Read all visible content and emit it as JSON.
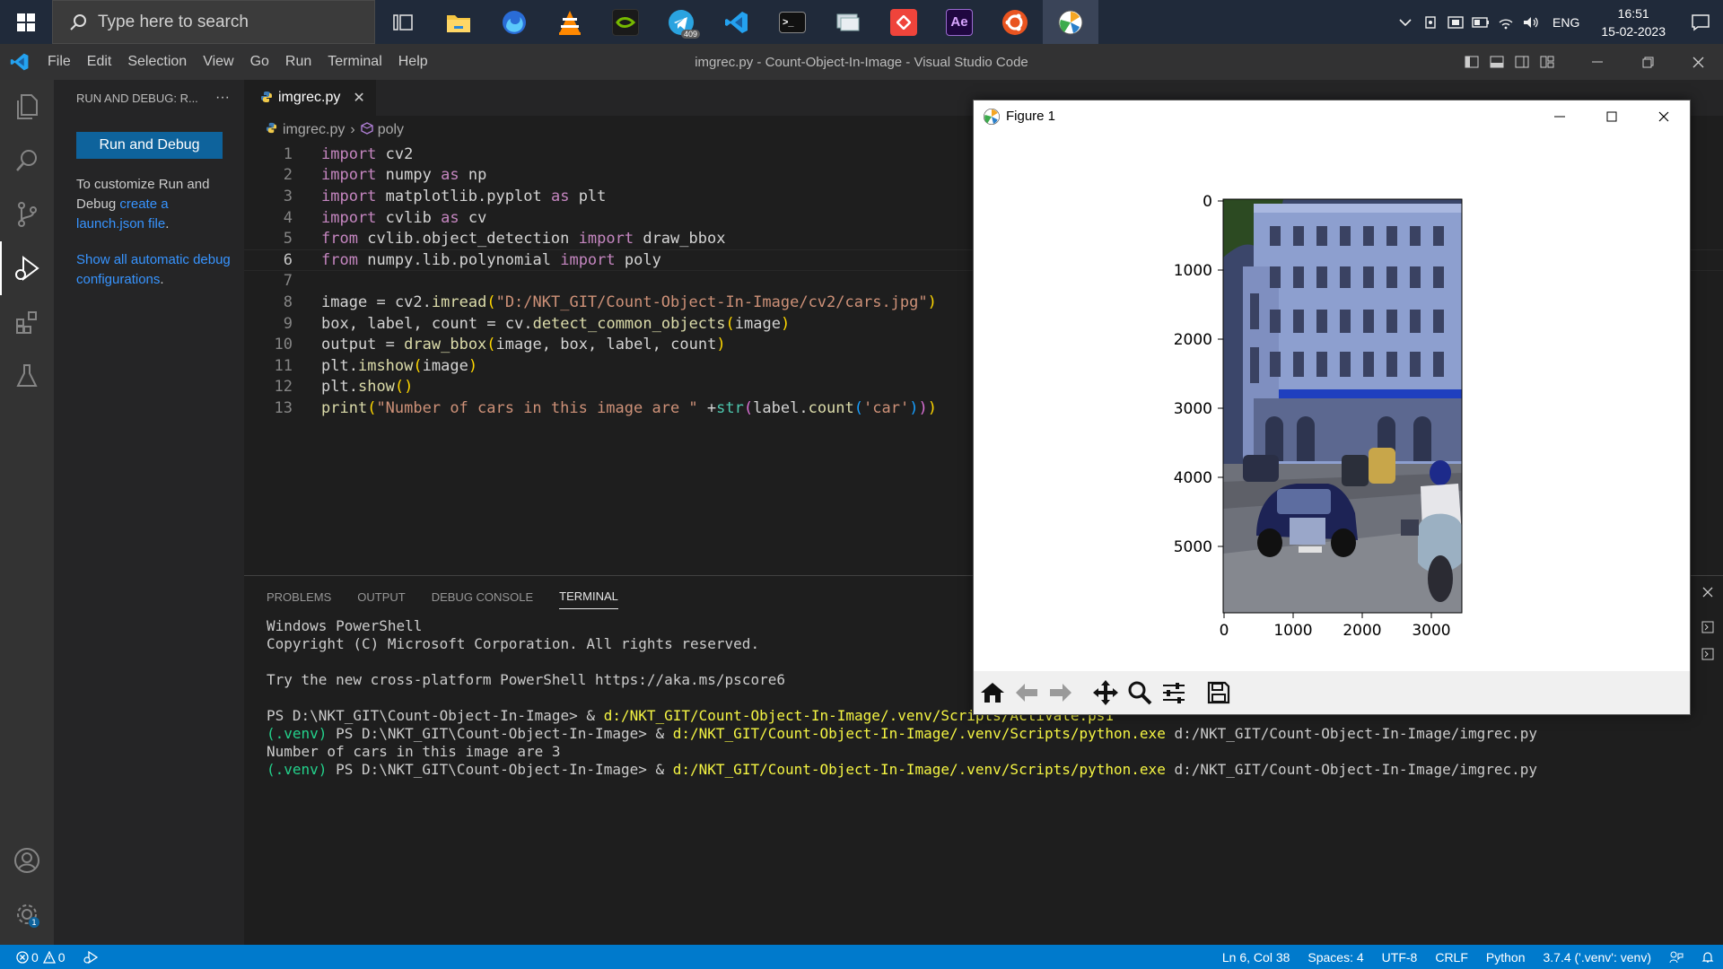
{
  "taskbar": {
    "search_placeholder": "Type here to search",
    "apps": [
      {
        "name": "Task View",
        "icon": "task-view-icon"
      },
      {
        "name": "File Explorer",
        "icon": "folder-icon"
      },
      {
        "name": "Firefox",
        "icon": "firefox-icon"
      },
      {
        "name": "VLC",
        "icon": "vlc-icon"
      },
      {
        "name": "NVIDIA",
        "icon": "nvidia-icon"
      },
      {
        "name": "Telegram",
        "icon": "telegram-icon",
        "badge": "409"
      },
      {
        "name": "Visual Studio Code",
        "icon": "vscode-icon"
      },
      {
        "name": "Terminal",
        "icon": "terminal-icon"
      },
      {
        "name": "Remote Desktop",
        "icon": "remote-desktop-icon"
      },
      {
        "name": "AnyDesk",
        "icon": "anydesk-icon"
      },
      {
        "name": "After Effects",
        "icon": "after-effects-icon",
        "label": "Ae"
      },
      {
        "name": "Ubuntu",
        "icon": "ubuntu-icon"
      },
      {
        "name": "Matplotlib Figure",
        "icon": "matplotlib-icon"
      }
    ],
    "language": "ENG",
    "time": "16:51",
    "date": "15-02-2023"
  },
  "titlebar": {
    "menu": [
      "File",
      "Edit",
      "Selection",
      "View",
      "Go",
      "Run",
      "Terminal",
      "Help"
    ],
    "title": "imgrec.py - Count-Object-In-Image - Visual Studio Code"
  },
  "sidebar": {
    "header": "RUN AND DEBUG: R...",
    "more": "···",
    "run_button": "Run and Debug",
    "customize_prefix": "To customize Run and Debug ",
    "customize_link": "create a launch.json file",
    "customize_suffix": ".",
    "show_link": "Show all automatic debug configurations",
    "show_suffix": "."
  },
  "editor": {
    "tab_label": "imgrec.py",
    "breadcrumb_file": "imgrec.py",
    "breadcrumb_symbol": "poly",
    "current_line": 6,
    "lines": [
      "import cv2",
      "import numpy as np",
      "import matplotlib.pyplot as plt",
      "import cvlib as cv",
      "from cvlib.object_detection import draw_bbox",
      "from numpy.lib.polynomial import poly",
      "",
      "image = cv2.imread(\"D:/NKT_GIT/Count-Object-In-Image/cv2/cars.jpg\")",
      "box, label, count = cv.detect_common_objects(image)",
      "output = draw_bbox(image, box, label, count)",
      "plt.imshow(image)",
      "plt.show()",
      "print(\"Number of cars in this image are \" +str(label.count('car')))"
    ]
  },
  "panel": {
    "tabs": [
      "PROBLEMS",
      "OUTPUT",
      "DEBUG CONSOLE",
      "TERMINAL"
    ],
    "active_tab": "TERMINAL",
    "terminal": {
      "line1": "Windows PowerShell",
      "line2": "Copyright (C) Microsoft Corporation. All rights reserved.",
      "line3": "Try the new cross-platform PowerShell https://aka.ms/pscore6",
      "cmd1_prompt": "PS D:\\NKT_GIT\\Count-Object-In-Image> & ",
      "cmd1_path": "d:/NKT_GIT/Count-Object-In-Image/.venv/Scripts/Activate.ps1",
      "venv": "(.venv)",
      "cmd2_prompt": " PS D:\\NKT_GIT\\Count-Object-In-Image> & ",
      "cmd2_path": "d:/NKT_GIT/Count-Object-In-Image/.venv/Scripts/python.exe",
      "cmd2_arg": " d:/NKT_GIT/Count-Object-In-Image/imgrec.py",
      "output": "Number of cars in this image are 3"
    }
  },
  "statusbar": {
    "errors": "0",
    "warnings": "0",
    "position": "Ln 6, Col 38",
    "spaces": "Spaces: 4",
    "encoding": "UTF-8",
    "eol": "CRLF",
    "language": "Python",
    "interpreter": "3.7.4 ('.venv': venv)"
  },
  "figure": {
    "title": "Figure 1",
    "y_ticks": [
      "0",
      "1000",
      "2000",
      "3000",
      "4000",
      "5000"
    ],
    "x_ticks": [
      "0",
      "1000",
      "2000",
      "3000"
    ],
    "toolbar": [
      "home-icon",
      "back-icon",
      "forward-icon",
      "pan-icon",
      "zoom-icon",
      "configure-icon",
      "save-icon"
    ]
  }
}
